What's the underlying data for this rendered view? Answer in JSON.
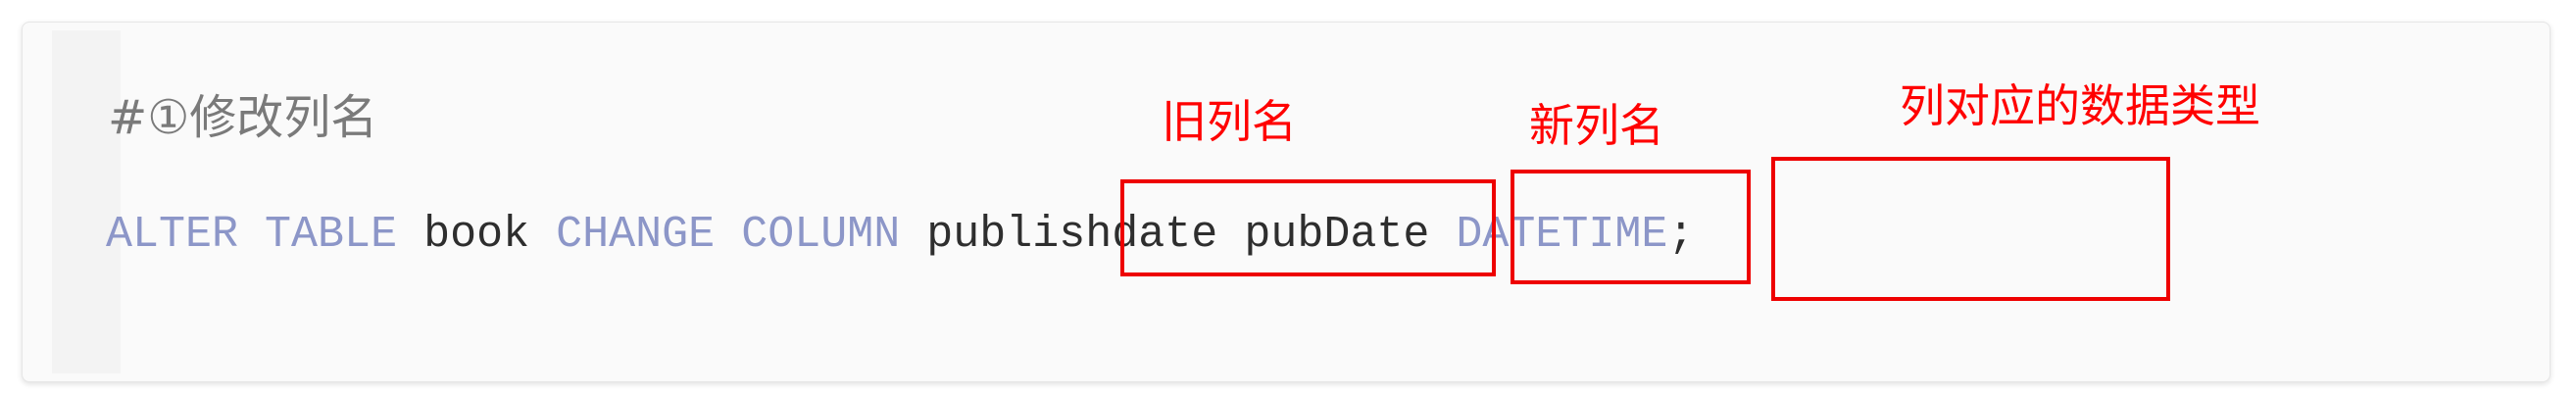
{
  "editor": {
    "comment": "#①修改列名",
    "code": {
      "alter_kw": "ALTER",
      "table_kw": "TABLE",
      "table_name": "book",
      "change_kw": "CHANGE",
      "column_kw": "COLUMN",
      "old_column": "publishdate",
      "new_column": "pubDate",
      "data_type": "DATETIME",
      "terminator": ";"
    }
  },
  "annotations": {
    "old_name_label": "旧列名",
    "new_name_label": "新列名",
    "type_label": "列对应的数据类型"
  },
  "colors": {
    "keyword": "#8c96c8",
    "identifier": "#2e2e2e",
    "comment": "#7a7a7a",
    "annotation": "#ff0000"
  }
}
